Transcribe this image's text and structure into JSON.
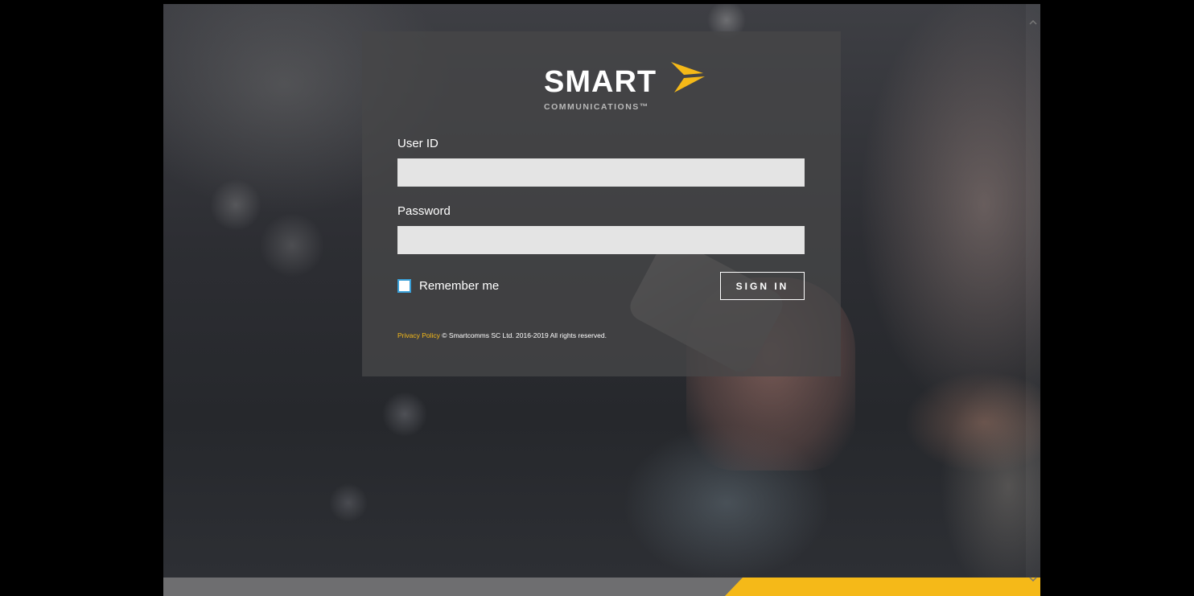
{
  "brand": {
    "name": "SMART",
    "tagline": "COMMUNICATIONS™",
    "accent_color": "#f5b918",
    "mark_icon": "double-chevron-arrow"
  },
  "login": {
    "user_id_label": "User ID",
    "user_id_value": "",
    "password_label": "Password",
    "password_value": "",
    "remember_label": "Remember me",
    "remember_checked": false,
    "signin_label": "SIGN IN"
  },
  "footer": {
    "privacy_label": "Privacy Policy",
    "copyright": "© Smartcomms SC Ltd. 2016-2019 All rights reserved."
  },
  "scrollbar": {
    "up_icon": "chevron-up",
    "down_icon": "chevron-down"
  }
}
